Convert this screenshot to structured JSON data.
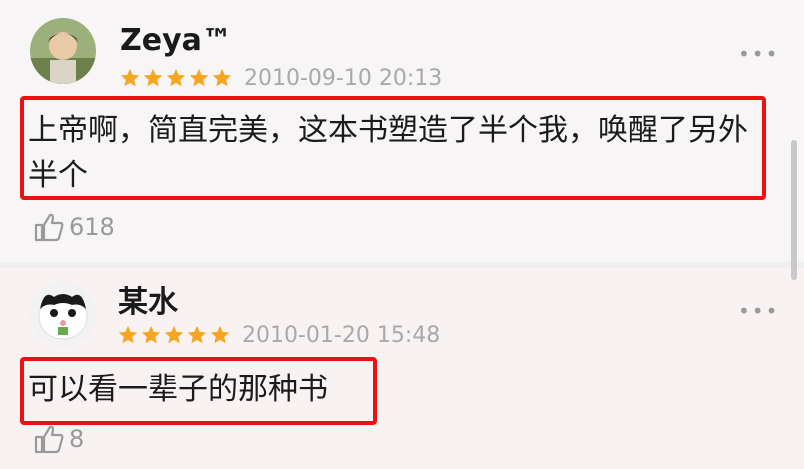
{
  "reviews": [
    {
      "username": "Zeya™",
      "rating": 5,
      "date": "2010-09-10 20:13",
      "content": "上帝啊，简直完美，这本书塑造了半个我，唤醒了另外半个",
      "likes": "618",
      "highlighted": true
    },
    {
      "username": "某水",
      "rating": 5,
      "date": "2010-01-20 15:48",
      "content": "可以看一辈子的那种书",
      "likes": "8",
      "highlighted": true
    }
  ],
  "more_label": "•••",
  "colors": {
    "star": "#f5a623",
    "highlight_border": "#ee1111",
    "date_text": "#a9a9a9"
  },
  "icons": [
    "star-icon",
    "thumbs-up-icon",
    "more-icon"
  ]
}
